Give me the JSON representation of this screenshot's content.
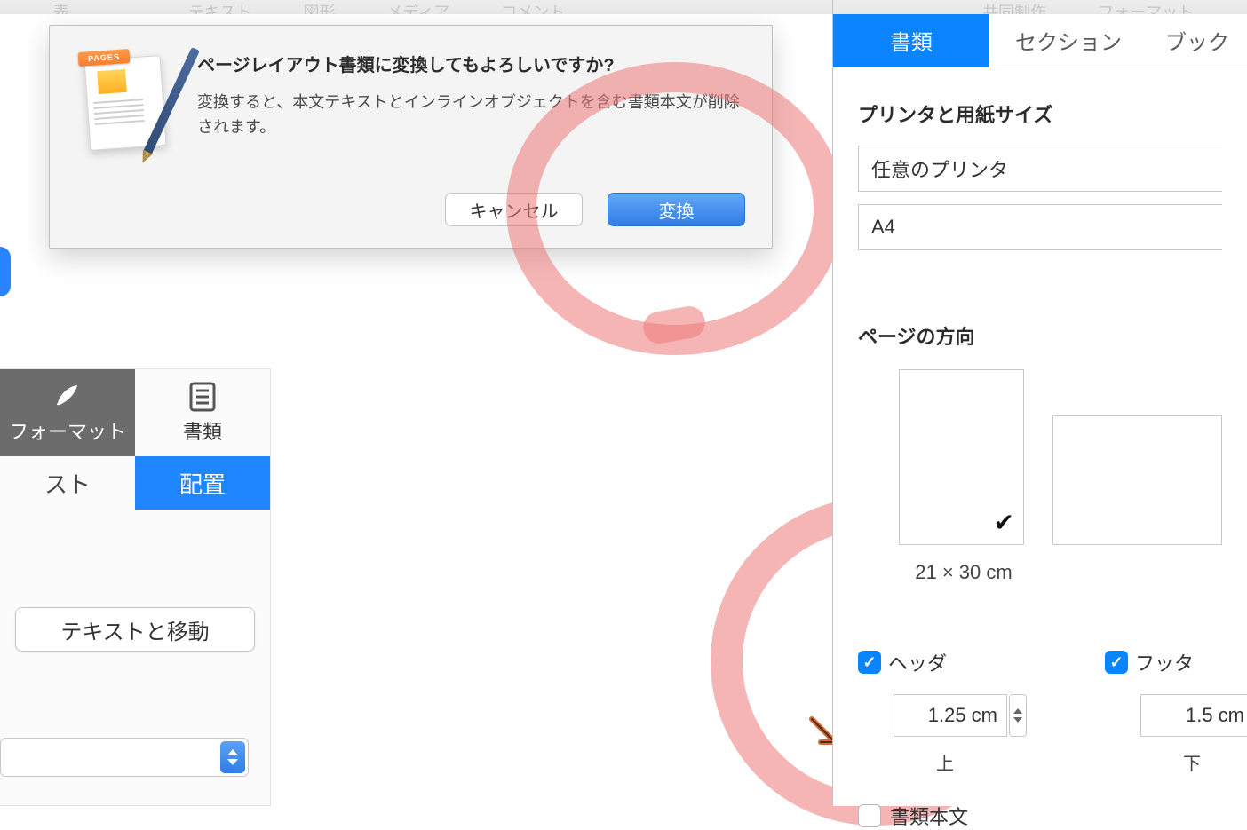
{
  "menubar": {
    "items": [
      "表",
      "…",
      "テキスト",
      "図形",
      "メディア",
      "コメント"
    ],
    "right": [
      "共同制作",
      "フォーマット"
    ]
  },
  "dialog": {
    "badge": "PAGES",
    "title": "ページレイアウト書類に変換してもよろしいですか?",
    "message": "変換すると、本文テキストとインラインオブジェクトを含む書類本文が削除されます。",
    "cancel": "キャンセル",
    "convert": "変換"
  },
  "palette": {
    "format_label": "フォーマット",
    "document_label": "書類",
    "tab_text": "スト",
    "tab_arrange": "配置",
    "move_with_text": "テキストと移動"
  },
  "inspector": {
    "tabs": {
      "document": "書類",
      "section": "セクション",
      "book": "ブック"
    },
    "printer_section_title": "プリンタと用紙サイズ",
    "printer_select": "任意のプリンタ",
    "paper_select": "A4",
    "orientation_title": "ページの方向",
    "orientation_caption": "21 × 30 cm",
    "header_label": "ヘッダ",
    "footer_label": "フッタ",
    "header_value": "1.25 cm",
    "footer_value": "1.5 cm",
    "top_label": "上",
    "bottom_label": "下",
    "body_text": "書類本文"
  }
}
